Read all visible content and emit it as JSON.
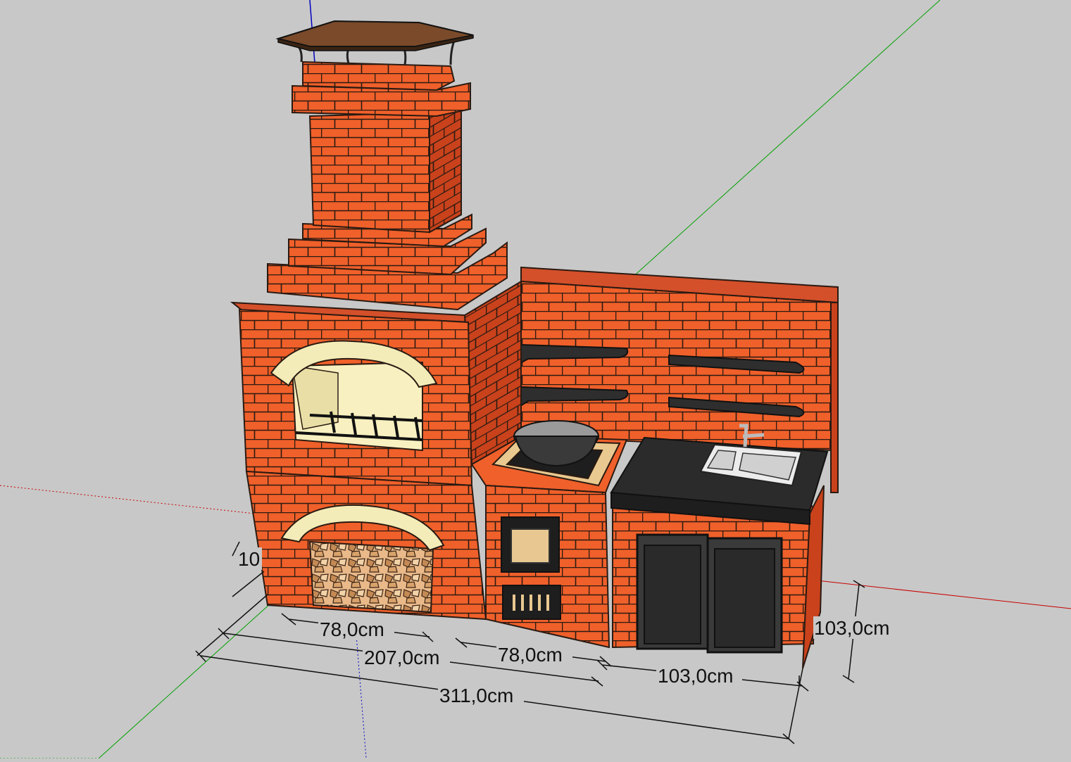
{
  "viewport": {
    "background": "#c8c8c8",
    "axis_colors": {
      "red": "#c80000",
      "green": "#00a000",
      "blue": "#0000c0"
    }
  },
  "model": {
    "brick_color": "#f0602a",
    "brick_shade": "#c9421c",
    "mortar_color": "#2a1a12",
    "arch_color": "#f4ecb8",
    "countertop_color": "#2b2b2b",
    "roof_color": "#7a4a2a"
  },
  "dimensions": {
    "d_left_stub": "10",
    "d_grill_width": "78,0cm",
    "d_left_total": "207,0cm",
    "d_stove_width": "78,0cm",
    "d_sink_width": "103,0cm",
    "d_total": "311,0cm",
    "d_depth": "103,0cm"
  }
}
